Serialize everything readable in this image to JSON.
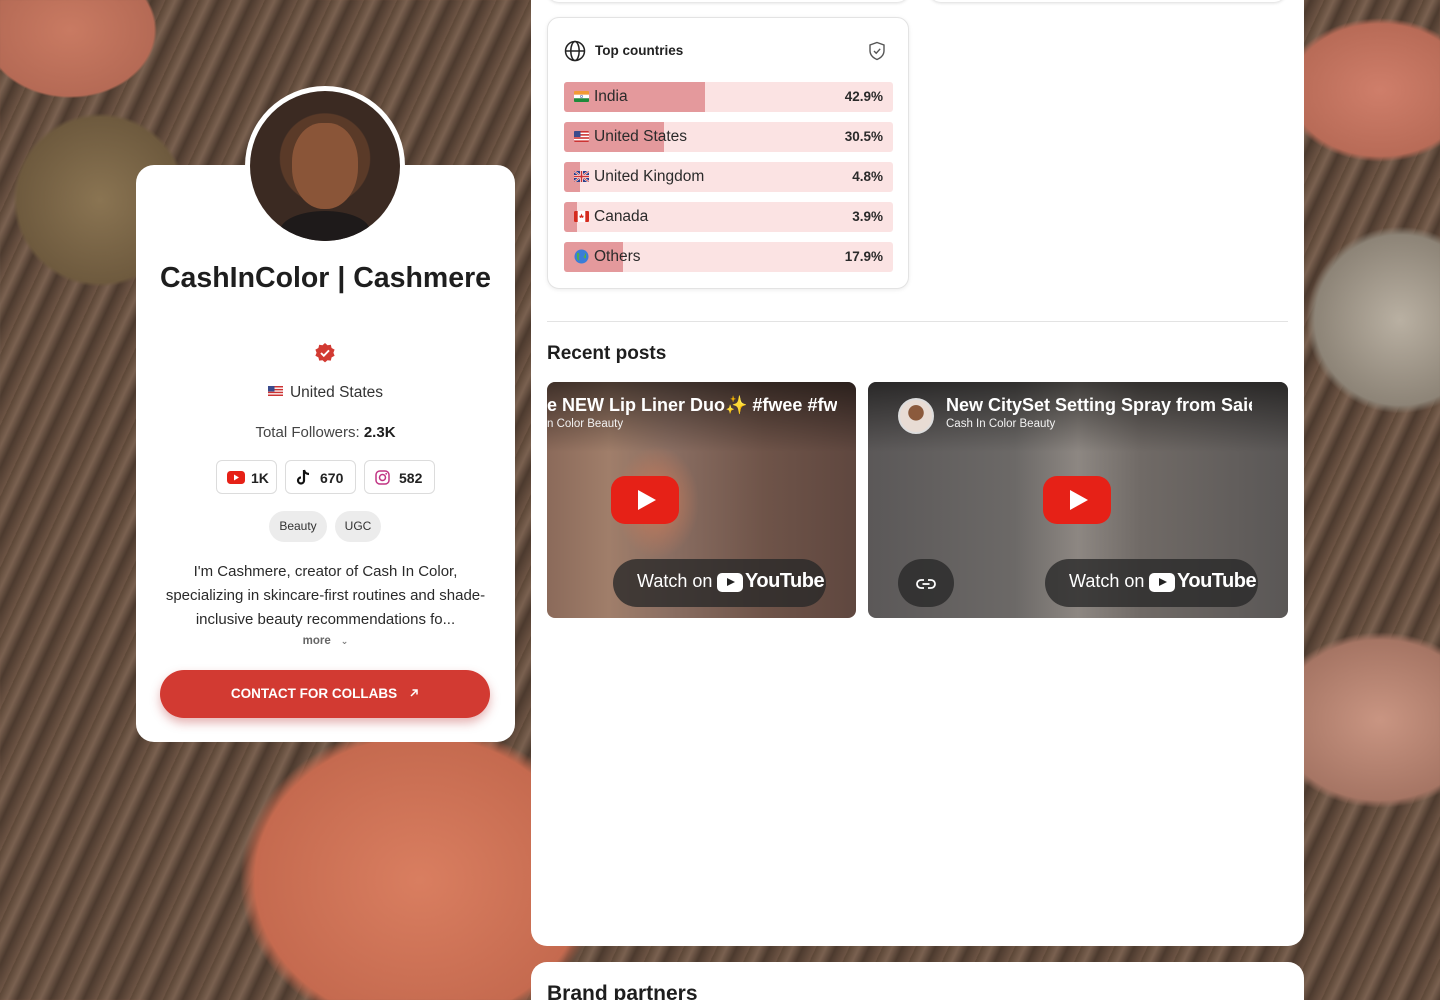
{
  "profile": {
    "name": "CashInColor | Cashmere",
    "location": "United States",
    "followers_label": "Total Followers:",
    "followers_value": "2.3K",
    "socials": [
      {
        "platform": "youtube-icon",
        "count": "1K"
      },
      {
        "platform": "tiktok-icon",
        "count": "670"
      },
      {
        "platform": "instagram-icon",
        "count": "582"
      }
    ],
    "tags": [
      "Beauty",
      "UGC"
    ],
    "bio": "I'm Cashmere, creator of Cash In Color, specializing in skincare-first routines and shade-inclusive beauty recommendations fo...",
    "more_label": "more",
    "contact_label": "CONTACT FOR COLLABS"
  },
  "countries": {
    "title": "Top countries",
    "items": [
      {
        "name": "India",
        "pct": "42.9%",
        "fill": 0.429
      },
      {
        "name": "United States",
        "pct": "30.5%",
        "fill": 0.305
      },
      {
        "name": "United Kingdom",
        "pct": "4.8%",
        "fill": 0.048
      },
      {
        "name": "Canada",
        "pct": "3.9%",
        "fill": 0.039
      },
      {
        "name": "Others",
        "pct": "17.9%",
        "fill": 0.179
      }
    ]
  },
  "recent_posts": {
    "title": "Recent posts",
    "videos": [
      {
        "title": "e NEW Lip Liner Duo✨ #fwee #fw",
        "channel": "n Color Beauty",
        "watch_label": "Watch on",
        "yt_label": "YouTube"
      },
      {
        "title": "New CitySet Setting Spray from Saie E",
        "channel": "Cash In Color Beauty",
        "watch_label": "Watch on",
        "yt_label": "YouTube"
      }
    ]
  },
  "brand_partners": {
    "title": "Brand partners"
  },
  "colors": {
    "accent": "#d23a32",
    "bar_fill": "#e4999c",
    "bar_bg": "#fbe3e3"
  }
}
